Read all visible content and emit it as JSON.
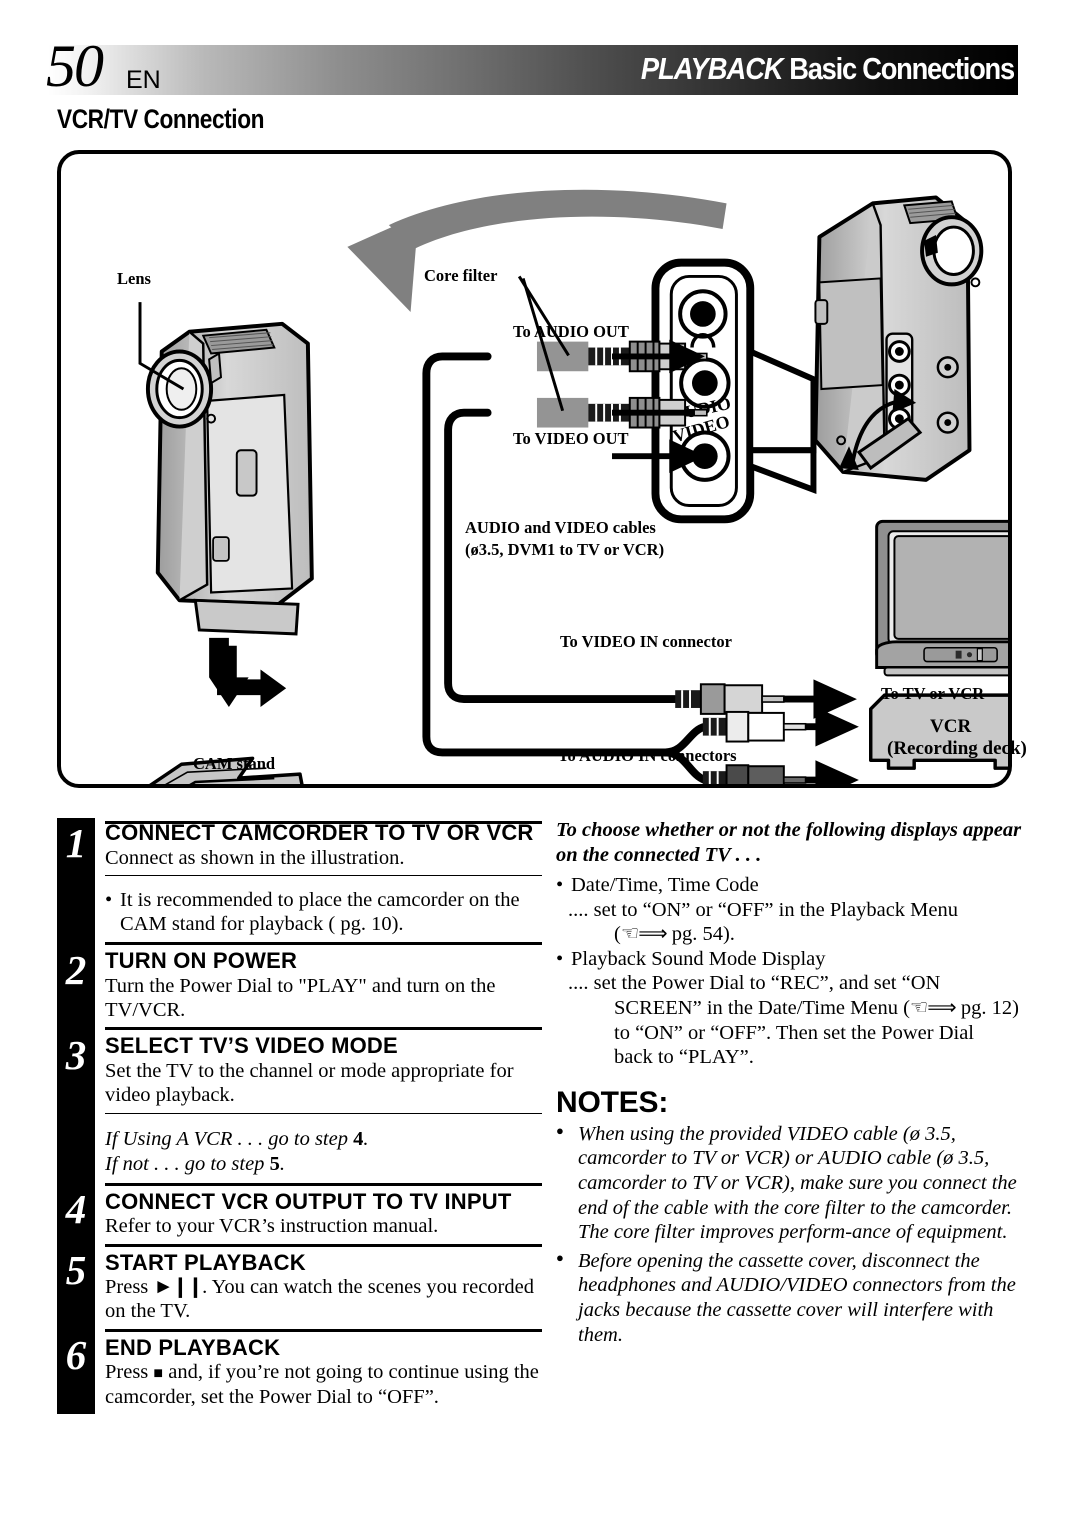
{
  "header": {
    "page_number": "50",
    "language": "EN",
    "title_italic": "PLAYBACK",
    "title_regular": "Basic Connections",
    "section_title": "VCR/TV Connection"
  },
  "diagram": {
    "labels": {
      "lens": "Lens",
      "core_filter": "Core filter",
      "to_audio_out": "To AUDIO OUT",
      "to_video_out": "To VIDEO OUT",
      "cables_line1": "AUDIO and VIDEO cables",
      "cables_line2": "(ø3.5, DVM1 to TV or VCR)",
      "to_video_in": "To VIDEO IN connector",
      "to_audio_in": "To AUDIO IN connectors",
      "cam_stand": "CAM stand",
      "to_tv_or_vcr": "To TV or VCR",
      "vcr_line1": "VCR",
      "vcr_line2": "(Recording deck)",
      "jack_audio": "AUDIO",
      "jack_video": "VIDEO"
    }
  },
  "steps": [
    {
      "number": "1",
      "title": "CONNECT CAMCORDER TO TV OR VCR",
      "body": "Connect as shown in the illustration.",
      "note": "It is recommended to place the camcorder on the CAM stand for playback ( pg. 10)."
    },
    {
      "number": "2",
      "title": "TURN ON POWER",
      "body": "Turn the Power Dial to \"PLAY\" and turn on the TV/VCR."
    },
    {
      "number": "3",
      "title": "SELECT TV’S VIDEO MODE",
      "body": "Set the TV to the channel or mode appropriate for video playback.",
      "italic_line1": "If Using A VCR . . . go to step ",
      "italic_line1_bold": "4",
      "italic_line2": "If not . . . go to step ",
      "italic_line2_bold": "5"
    },
    {
      "number": "4",
      "title": "CONNECT VCR OUTPUT TO TV INPUT",
      "body": "Refer to your VCR’s instruction manual."
    },
    {
      "number": "5",
      "title": "START PLAYBACK",
      "body": "Press . You can watch the scenes you recorded on the TV."
    },
    {
      "number": "6",
      "title": "END PLAYBACK",
      "body": "Press  and, if you’re not going to continue using the camcorder, set the Power Dial to “OFF”."
    }
  ],
  "right_column": {
    "lead": "To choose whether or not the following displays appear on the connected TV . . .",
    "bullet1": "Date/Time, Time Code",
    "bullet1_sub_a": ".... set to “ON” or “OFF” in the Playback Menu",
    "bullet1_sub_b": "( pg. 54).",
    "bullet2": "Playback Sound Mode Display",
    "bullet2_sub_a": ".... set the Power Dial to “REC”, and set “ON",
    "bullet2_sub_b": "SCREEN” in the Date/Time Menu ( pg. 12)",
    "bullet2_sub_c": "to “ON” or “OFF”. Then set the Power Dial",
    "bullet2_sub_d": "back to “PLAY”.",
    "notes_heading": "NOTES:",
    "note1": "When using the provided VIDEO cable (ø 3.5, camcorder to TV or VCR) or AUDIO cable (ø 3.5, camcorder to TV or VCR), make sure you connect the end of the cable with the core filter to the camcorder. The core filter improves perform-ance of equipment.",
    "note2": "Before opening the cassette cover, disconnect the headphones and AUDIO/VIDEO connectors from the jacks because the cassette cover will interfere with them."
  }
}
